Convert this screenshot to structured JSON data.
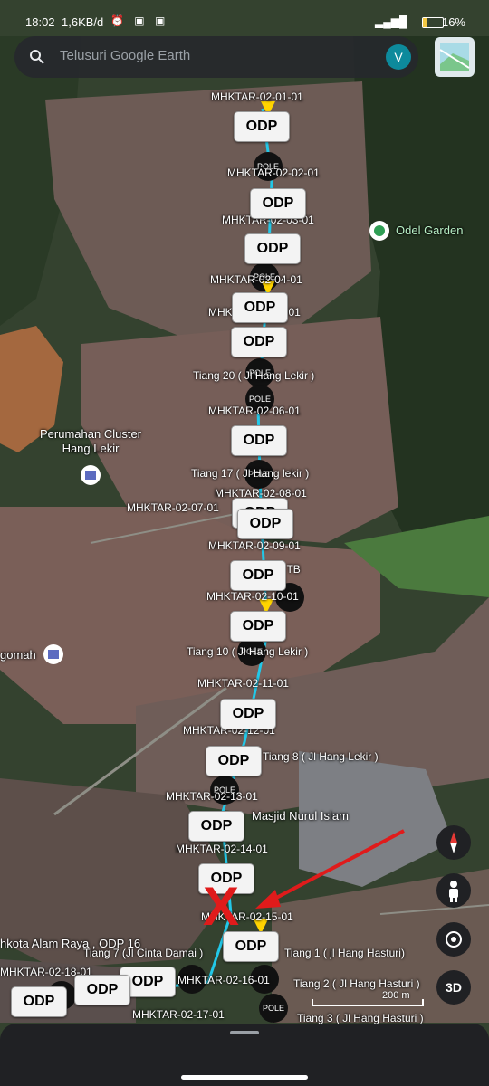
{
  "status_bar": {
    "time": "18:02",
    "speed": "1,6KB/d",
    "battery": "16%"
  },
  "search": {
    "placeholder": "Telusuri Google Earth",
    "avatar_letter": "V"
  },
  "places": {
    "odel_garden": "Odel Garden",
    "perumahan": "Perumahan Cluster\nHang Lekir",
    "masjid": "Masjid Nurul Islam",
    "left_gomah": "gomah",
    "left_alam_raya": "hkota Alam Raya , ODP 16"
  },
  "labels": {
    "l1": "MHKTAR-02-01-01",
    "l2": "MHKTAR-02-02-01",
    "l3": "MHKTAR-02-03-01",
    "l4": "MHKTAR-02-04-01",
    "l5": "MHKTAR-02-05-01",
    "l6": "Tiang 20 ( Jl Hang Lekir )",
    "l7": "MHKTAR-02-06-01",
    "l8": "Tiang 17 ( Jl Hang lekir )",
    "l9": "MHKTAR-02-08-01",
    "l10": "MHKTAR-02-07-01",
    "l11": "MHKTAR-02-09-01",
    "l12": "23 TB",
    "l13": "MHKTAR-02-10-01",
    "l14": "Tiang 10 ( Jl Hang Lekir )",
    "l15": "MHKTAR-02-11-01",
    "l16": "MHKTAR-02-12-01",
    "l17": "Tiang 8 ( Jl Hang Lekir )",
    "l18": "MHKTAR-02-13-01",
    "l19": "MHKTAR-02-14-01",
    "l20": "MHKTAR-02-15-01",
    "l21": "Tiang 7 (Jl Cinta Damai )",
    "l22": "Tiang 1 ( jl Hang Hasturi)",
    "l23": "MHKTAR-02-18-01",
    "l24": "MHKTAR-02-16-01",
    "l25": "Tiang 2 ( Jl Hang Hasturi )",
    "l26": "MHKTAR-02-17-01",
    "l27": "Tiang 3 ( Jl Hang Hasturi )"
  },
  "odp_text": "ODP",
  "pole_text": "POLE",
  "scale_label": "200 m",
  "view_mode": "3D",
  "marker": "X",
  "colors": {
    "odp_bg": "#f3f3f3",
    "pole": "#111111",
    "pin": "#ffd400",
    "arrow": "#e01b1b",
    "route": "#22c8e8"
  }
}
